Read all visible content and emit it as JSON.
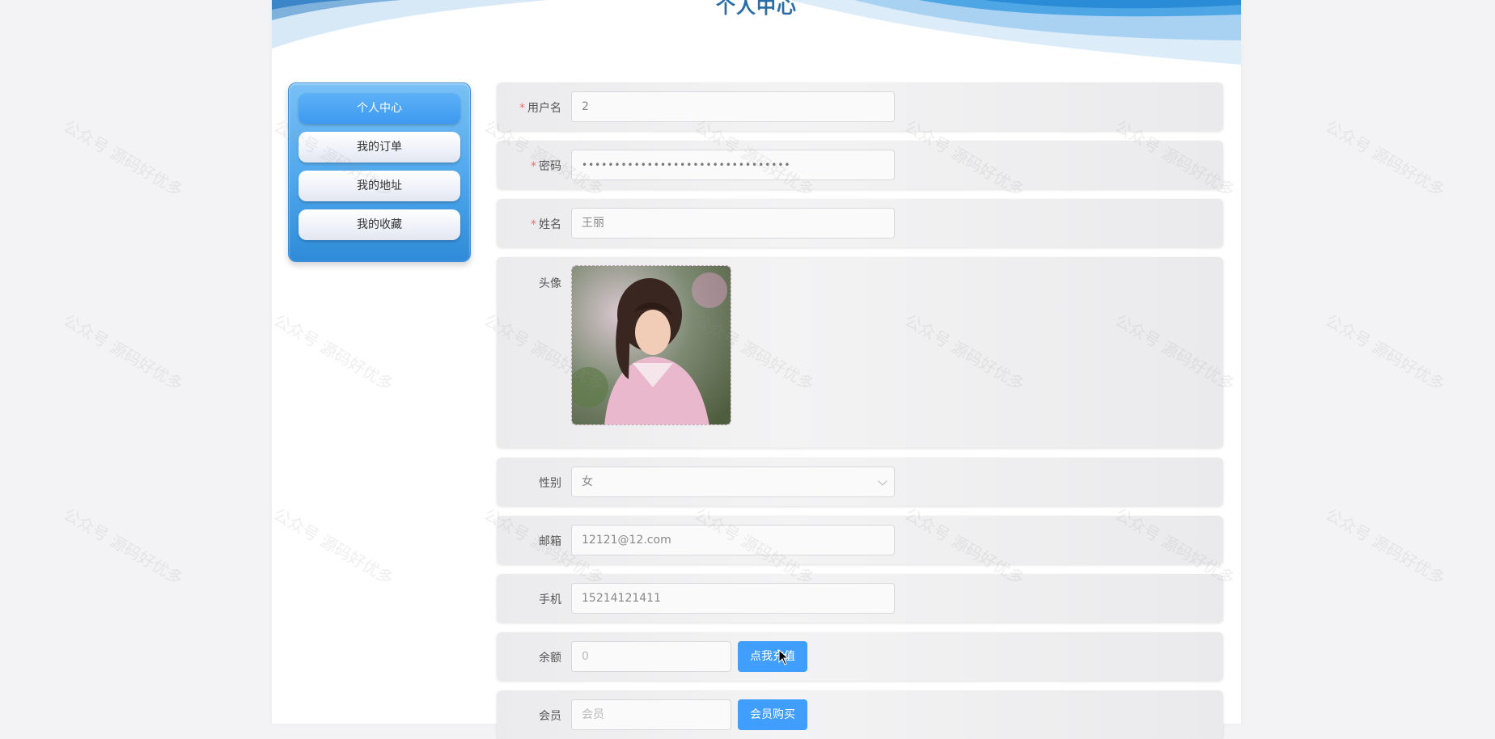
{
  "header": {
    "title": "个人中心"
  },
  "sidebar": {
    "items": [
      {
        "label": "个人中心",
        "active": true
      },
      {
        "label": "我的订单",
        "active": false
      },
      {
        "label": "我的地址",
        "active": false
      },
      {
        "label": "我的收藏",
        "active": false
      }
    ]
  },
  "form": {
    "username": {
      "label": "用户名",
      "value": "2",
      "required": true
    },
    "password": {
      "label": "密码",
      "value": "••••••••••••••••••••••••••••••••",
      "required": true
    },
    "name": {
      "label": "姓名",
      "value": "王丽",
      "required": true
    },
    "avatar": {
      "label": "头像"
    },
    "gender": {
      "label": "性别",
      "value": "女"
    },
    "email": {
      "label": "邮箱",
      "value": "12121@12.com"
    },
    "phone": {
      "label": "手机",
      "value": "15214121411"
    },
    "balance": {
      "label": "余额",
      "value": "0",
      "button": "点我充值"
    },
    "member": {
      "label": "会员",
      "placeholder": "会员",
      "button": "会员购买"
    }
  },
  "watermark_text": "公众号 源码好优多",
  "colors": {
    "primary": "#409eff",
    "title": "#2a6ea8",
    "required": "#f56c6c"
  }
}
